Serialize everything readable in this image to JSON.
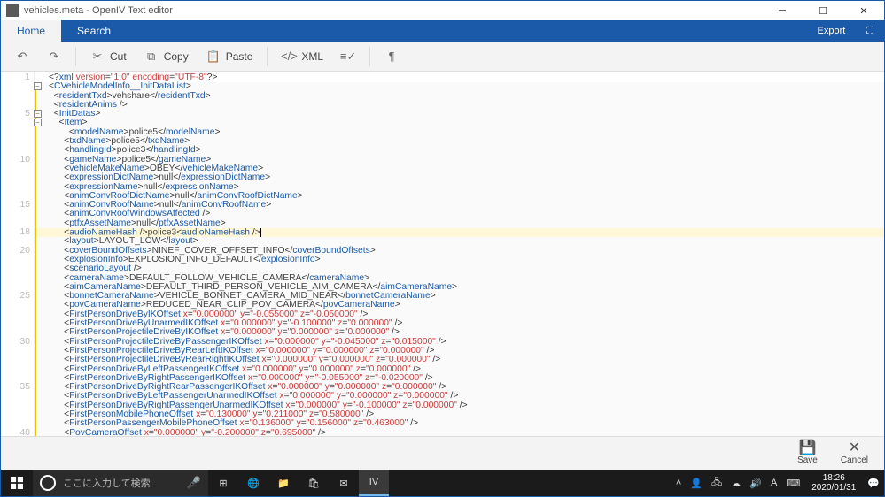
{
  "title": "vehicles.meta - OpenIV Text editor",
  "ribbon": {
    "tabs": {
      "home": "Home",
      "search": "Search"
    },
    "export": "Export",
    "buttons": {
      "undo": "",
      "redo": "",
      "cut": "Cut",
      "copy": "Copy",
      "paste": "Paste",
      "xml": "XML"
    }
  },
  "bottom": {
    "save": "Save",
    "cancel": "Cancel"
  },
  "taskbar": {
    "search_placeholder": "ここに入力して検索",
    "time": "18:26",
    "date": "2020/01/31",
    "ime": "A"
  },
  "gutter": {
    "1": "1",
    "5": "5",
    "10": "10",
    "15": "15",
    "18": "18",
    "20": "20",
    "25": "25",
    "30": "30",
    "35": "35",
    "40": "40"
  },
  "code_lines": [
    {
      "indent": 0,
      "raw": "<?xml version=\"1.0\" encoding=\"UTF-8\"?>",
      "kind": "pi"
    },
    {
      "indent": 0,
      "open": "CVehicleModelInfo__InitDataList",
      "fold": true
    },
    {
      "indent": 1,
      "open": "residentTxd",
      "text": "vehshare",
      "close": "residentTxd"
    },
    {
      "indent": 1,
      "selfclose": "residentAnims"
    },
    {
      "indent": 1,
      "open": "InitDatas",
      "fold": true
    },
    {
      "indent": 2,
      "open": "Item",
      "fold": true
    },
    {
      "indent": 4,
      "open": "modelName",
      "text": "police5",
      "close": "modelName"
    },
    {
      "indent": 3,
      "open": "txdName",
      "text": "police5",
      "close": "txdName"
    },
    {
      "indent": 3,
      "open": "handlingId",
      "text": "police3",
      "close": "handlingId"
    },
    {
      "indent": 3,
      "open": "gameName",
      "text": "police5",
      "close": "gameName"
    },
    {
      "indent": 3,
      "open": "vehicleMakeName",
      "text": "OBEY",
      "close": "vehicleMakeName"
    },
    {
      "indent": 3,
      "open": "expressionDictName",
      "text": "null",
      "close": "expressionDictName"
    },
    {
      "indent": 3,
      "open": "expressionName",
      "text": "null",
      "close": "expressionName"
    },
    {
      "indent": 3,
      "open": "animConvRoofDictName",
      "text": "null",
      "close": "animConvRoofDictName"
    },
    {
      "indent": 3,
      "open": "animConvRoofName",
      "text": "null",
      "close": "animConvRoofName"
    },
    {
      "indent": 3,
      "selfclose": "animConvRoofWindowsAffected"
    },
    {
      "indent": 3,
      "open": "ptfxAssetName",
      "text": "null",
      "close": "ptfxAssetName"
    },
    {
      "indent": 3,
      "raw_mixed": [
        "<audioNameHash />",
        "police3",
        "<audioNameHash />"
      ],
      "hl": true,
      "caret": true
    },
    {
      "indent": 3,
      "open": "layout",
      "text": "LAYOUT_LOW",
      "close": "layout"
    },
    {
      "indent": 3,
      "open": "coverBoundOffsets",
      "text": "NINEF_COVER_OFFSET_INFO",
      "close": "coverBoundOffsets"
    },
    {
      "indent": 3,
      "open": "explosionInfo",
      "text": "EXPLOSION_INFO_DEFAULT",
      "close": "explosionInfo"
    },
    {
      "indent": 3,
      "selfclose": "scenarioLayout"
    },
    {
      "indent": 3,
      "open": "cameraName",
      "text": "DEFAULT_FOLLOW_VEHICLE_CAMERA",
      "close": "cameraName"
    },
    {
      "indent": 3,
      "open": "aimCameraName",
      "text": "DEFAULT_THIRD_PERSON_VEHICLE_AIM_CAMERA",
      "close": "aimCameraName"
    },
    {
      "indent": 3,
      "open": "bonnetCameraName",
      "text": "VEHICLE_BONNET_CAMERA_MID_NEAR",
      "close": "bonnetCameraName"
    },
    {
      "indent": 3,
      "open": "povCameraName",
      "text": "REDUCED_NEAR_CLIP_POV_CAMERA",
      "close": "povCameraName"
    },
    {
      "indent": 3,
      "attrs_tag": "FirstPersonDriveByIKOffset",
      "attrs": {
        "x": "0.000000",
        "y": "-0.055000",
        "z": "-0.050000"
      }
    },
    {
      "indent": 3,
      "attrs_tag": "FirstPersonDriveByUnarmedIKOffset",
      "attrs": {
        "x": "0.000000",
        "y": "-0.100000",
        "z": "0.000000"
      }
    },
    {
      "indent": 3,
      "attrs_tag": "FirstPersonProjectileDriveByIKOffset",
      "attrs": {
        "x": "0.000000",
        "y": "0.000000",
        "z": "0.000000"
      }
    },
    {
      "indent": 3,
      "attrs_tag": "FirstPersonProjectileDriveByPassengerIKOffset",
      "attrs": {
        "x": "0.000000",
        "y": "-0.045000",
        "z": "0.015000"
      }
    },
    {
      "indent": 3,
      "attrs_tag": "FirstPersonProjectileDriveByRearLeftIKOffset",
      "attrs": {
        "x": "0.000000",
        "y": "0.000000",
        "z": "0.000000"
      }
    },
    {
      "indent": 3,
      "attrs_tag": "FirstPersonProjectileDriveByRearRightIKOffset",
      "attrs": {
        "x": "0.000000",
        "y": "0.000000",
        "z": "0.000000"
      }
    },
    {
      "indent": 3,
      "attrs_tag": "FirstPersonDriveByLeftPassengerIKOffset",
      "attrs": {
        "x": "0.000000",
        "y": "0.000000",
        "z": "0.000000"
      }
    },
    {
      "indent": 3,
      "attrs_tag": "FirstPersonDriveByRightPassengerIKOffset",
      "attrs": {
        "x": "0.000000",
        "y": "-0.055000",
        "z": "-0.020000"
      }
    },
    {
      "indent": 3,
      "attrs_tag": "FirstPersonDriveByRightRearPassengerIKOffset",
      "attrs": {
        "x": "0.000000",
        "y": "0.000000",
        "z": "0.000000"
      }
    },
    {
      "indent": 3,
      "attrs_tag": "FirstPersonDriveByLeftPassengerUnarmedIKOffset",
      "attrs": {
        "x": "0.000000",
        "y": "0.000000",
        "z": "0.000000"
      }
    },
    {
      "indent": 3,
      "attrs_tag": "FirstPersonDriveByRightPassengerUnarmedIKOffset",
      "attrs": {
        "x": "0.000000",
        "y": "-0.100000",
        "z": "0.000000"
      }
    },
    {
      "indent": 3,
      "attrs_tag": "FirstPersonMobilePhoneOffset",
      "attrs": {
        "x": "0.130000",
        "y": "0.211000",
        "z": "0.580000"
      }
    },
    {
      "indent": 3,
      "attrs_tag": "FirstPersonPassengerMobilePhoneOffset",
      "attrs": {
        "x": "0.136000",
        "y": "0.156000",
        "z": "0.463000"
      }
    },
    {
      "indent": 3,
      "attrs_tag": "PovCameraOffset",
      "attrs": {
        "x": "0.000000",
        "y": "-0.200000",
        "z": "0.695000"
      }
    }
  ]
}
